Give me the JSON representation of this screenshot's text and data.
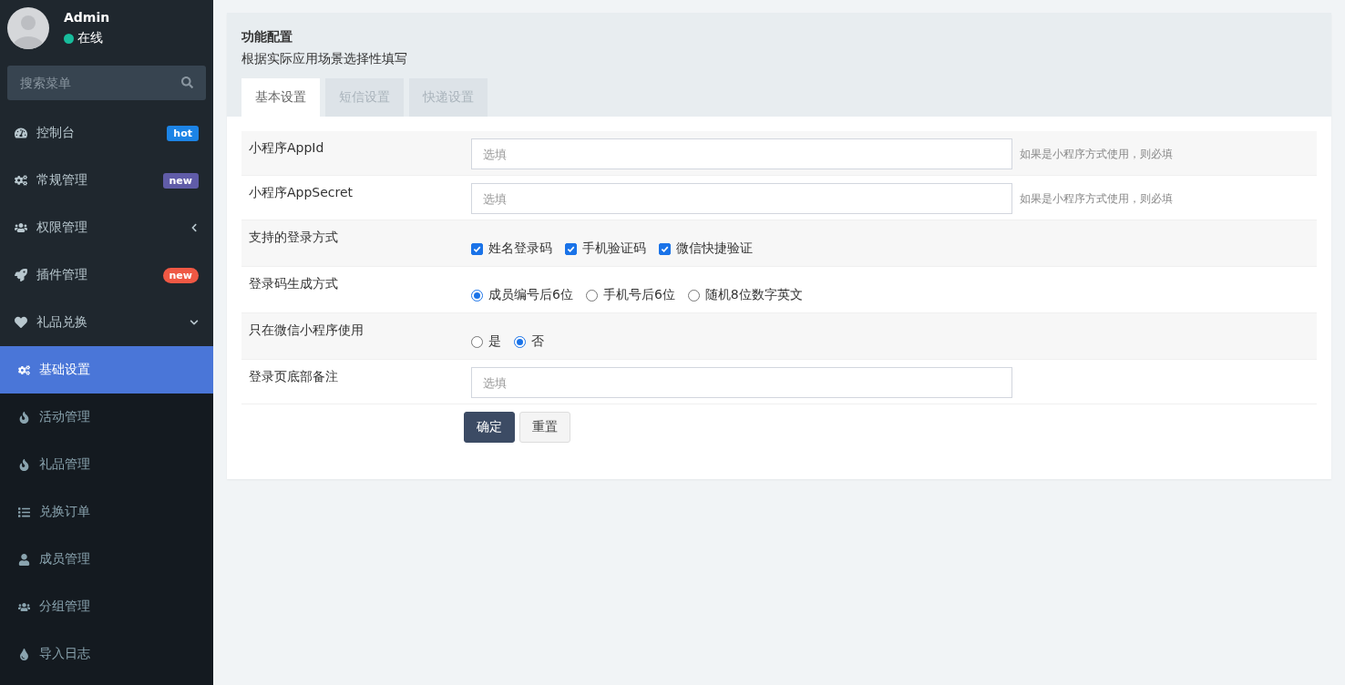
{
  "user": {
    "name": "Admin",
    "status": "在线",
    "online": true
  },
  "search": {
    "placeholder": "搜索菜单"
  },
  "menu": [
    {
      "label": "控制台",
      "badge": {
        "text": "hot",
        "kind": "label",
        "color": "#1c84e6"
      },
      "selected": false
    },
    {
      "label": "常规管理",
      "badge": {
        "text": "new",
        "kind": "label",
        "color": "#605ca8"
      },
      "selected": false
    },
    {
      "label": "权限管理",
      "expanded": false,
      "selected": false
    },
    {
      "label": "插件管理",
      "badge": {
        "text": "new",
        "kind": "pill",
        "color": "#ef5844"
      },
      "selected": false
    },
    {
      "label": "礼品兑换",
      "expanded": true,
      "selected": false,
      "children": [
        {
          "label": "基础设置",
          "selected": true
        },
        {
          "label": "活动管理",
          "selected": false
        },
        {
          "label": "礼品管理",
          "selected": false
        },
        {
          "label": "兑换订单",
          "selected": false
        },
        {
          "label": "成员管理",
          "selected": false
        },
        {
          "label": "分组管理",
          "selected": false
        },
        {
          "label": "导入日志",
          "selected": false
        }
      ]
    }
  ],
  "panel": {
    "title": "功能配置",
    "subtitle": "根据实际应用场景选择性填写",
    "tabs": [
      {
        "label": "基本设置",
        "selected": true
      },
      {
        "label": "短信设置",
        "selected": false
      },
      {
        "label": "快递设置",
        "selected": false
      }
    ],
    "rows": [
      {
        "kind": "input",
        "label": "小程序AppId",
        "placeholder": "选填",
        "hint": "如果是小程序方式使用，则必填"
      },
      {
        "kind": "input",
        "label": "小程序AppSecret",
        "placeholder": "选填",
        "hint": "如果是小程序方式使用，则必填"
      },
      {
        "kind": "checkbox",
        "label": "支持的登录方式",
        "options": [
          {
            "label": "姓名登录码",
            "checked": true
          },
          {
            "label": "手机验证码",
            "checked": true
          },
          {
            "label": "微信快捷验证",
            "checked": true
          }
        ]
      },
      {
        "kind": "radio",
        "label": "登录码生成方式",
        "options": [
          {
            "label": "成员编号后6位",
            "selected": true
          },
          {
            "label": "手机号后6位",
            "selected": false
          },
          {
            "label": "随机8位数字英文",
            "selected": false
          }
        ]
      },
      {
        "kind": "radio",
        "label": "只在微信小程序使用",
        "options": [
          {
            "label": "是",
            "selected": false
          },
          {
            "label": "否",
            "selected": true
          }
        ]
      },
      {
        "kind": "input",
        "label": "登录页底部备注",
        "placeholder": "选填"
      }
    ],
    "buttons": [
      {
        "kind": "primary",
        "label": "确定"
      },
      {
        "kind": "default",
        "label": "重置"
      }
    ]
  }
}
